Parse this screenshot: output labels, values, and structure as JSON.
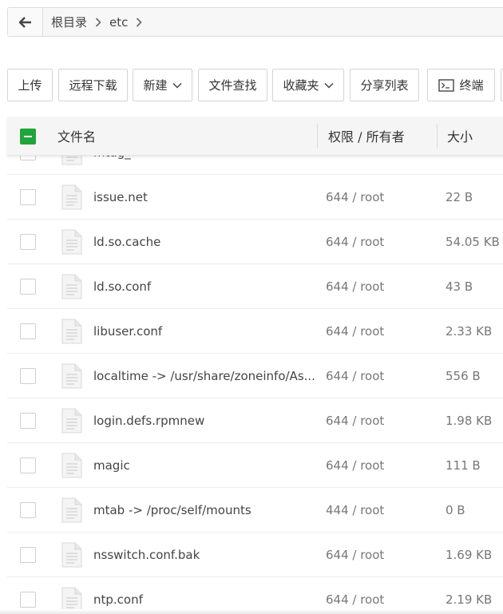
{
  "breadcrumb": {
    "items": [
      "根目录",
      "etc"
    ]
  },
  "toolbar": {
    "upload": "上传",
    "remote_download": "远程下载",
    "new": "新建",
    "file_search": "文件查找",
    "favorites": "收藏夹",
    "share_list": "分享列表",
    "terminal": "终端"
  },
  "table": {
    "headers": {
      "name": "文件名",
      "perm": "权限 / 所有者",
      "size": "大小"
    },
    "rows": [
      {
        "name": "mtag_",
        "perm": "",
        "size": ""
      },
      {
        "name": "issue.net",
        "perm": "644 / root",
        "size": "22 B"
      },
      {
        "name": "ld.so.cache",
        "perm": "644 / root",
        "size": "54.05 KB"
      },
      {
        "name": "ld.so.conf",
        "perm": "644 / root",
        "size": "43 B"
      },
      {
        "name": "libuser.conf",
        "perm": "644 / root",
        "size": "2.33 KB"
      },
      {
        "name": "localtime -> /usr/share/zoneinfo/As...",
        "perm": "644 / root",
        "size": "556 B"
      },
      {
        "name": "login.defs.rpmnew",
        "perm": "644 / root",
        "size": "1.98 KB"
      },
      {
        "name": "magic",
        "perm": "644 / root",
        "size": "111 B"
      },
      {
        "name": "mtab -> /proc/self/mounts",
        "perm": "444 / root",
        "size": "0 B"
      },
      {
        "name": "nsswitch.conf.bak",
        "perm": "644 / root",
        "size": "1.69 KB"
      },
      {
        "name": "ntp.conf",
        "perm": "644 / root",
        "size": "2.19 KB"
      }
    ]
  },
  "colors": {
    "accent": "#20a53a",
    "border": "#d5d5d5",
    "header_bg": "#f5f5f5"
  },
  "icons": {
    "back": "arrow-left-icon",
    "chevron": "chevron-right-icon",
    "dropdown": "chevron-down-icon",
    "terminal": "terminal-icon",
    "file": "file-icon"
  }
}
